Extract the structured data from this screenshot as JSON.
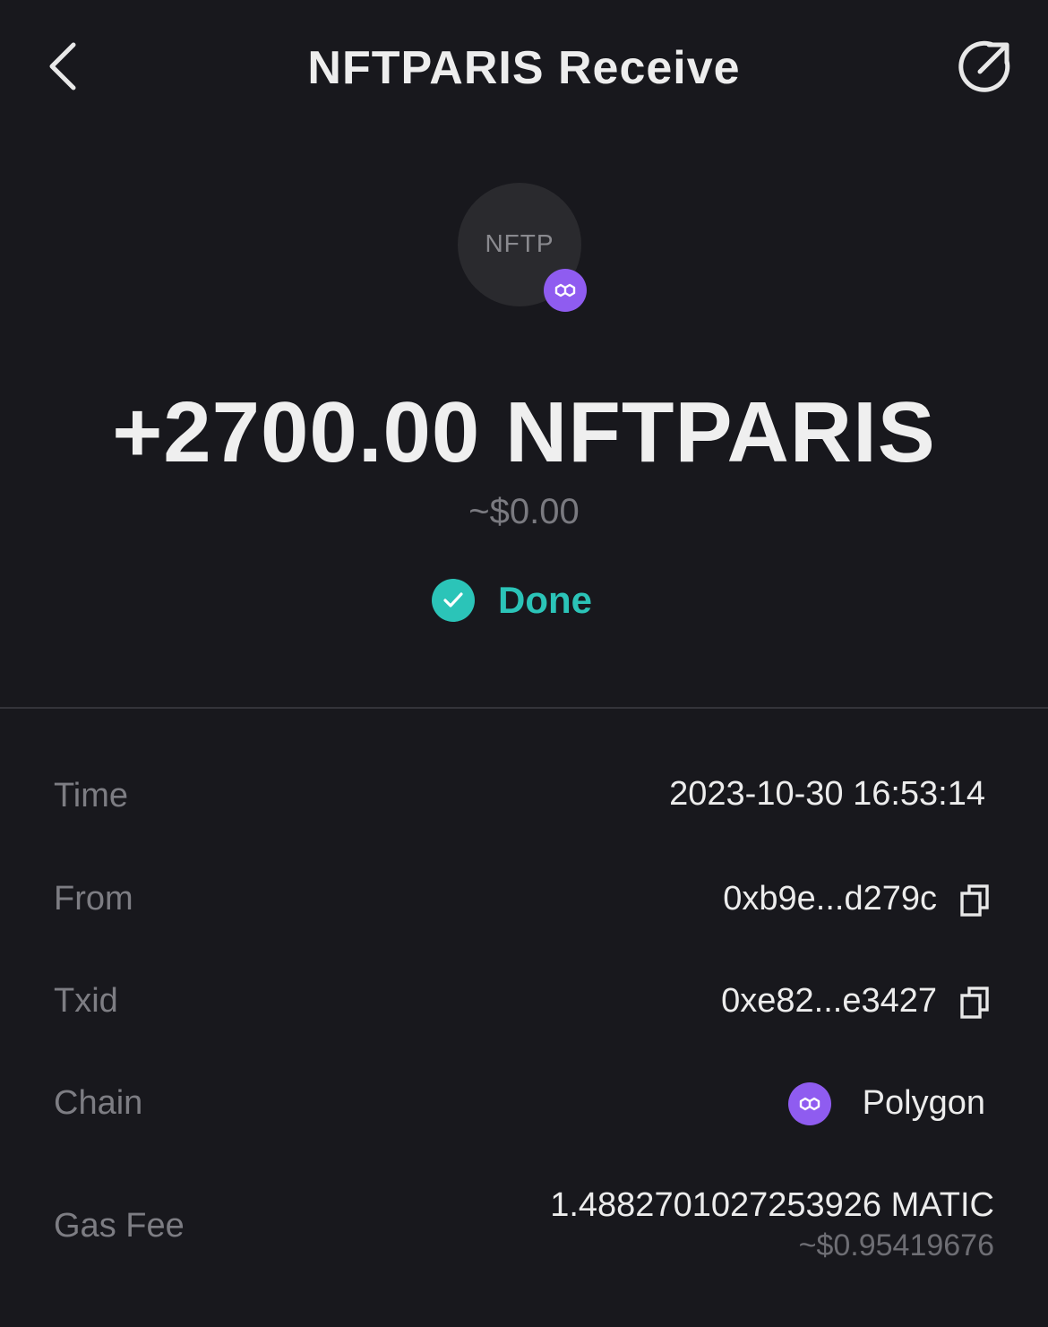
{
  "header": {
    "title": "NFTPARIS Receive",
    "back_icon": "chevron-left-icon",
    "share_icon": "external-link-icon"
  },
  "token": {
    "avatar_text": "NFTP",
    "chain_badge_icon": "polygon-icon"
  },
  "amount": "+2700.00 NFTPARIS",
  "fiat_amount": "~$0.00",
  "status": {
    "label": "Done",
    "icon": "check-circle-icon",
    "color": "#2bc4b8"
  },
  "details": {
    "time": {
      "label": "Time",
      "value": "2023-10-30 16:53:14"
    },
    "from": {
      "label": "From",
      "value": "0xb9e...d279c",
      "copy_icon": "copy-icon"
    },
    "txid": {
      "label": "Txid",
      "value": "0xe82...e3427",
      "copy_icon": "copy-icon"
    },
    "chain": {
      "label": "Chain",
      "value": "Polygon",
      "icon": "polygon-icon"
    },
    "gas_fee": {
      "label": "Gas Fee",
      "value": "1.4882701027253926 MATIC",
      "fiat": "~$0.95419676"
    }
  },
  "colors": {
    "background": "#18181d",
    "polygon_purple": "#8f5cf0",
    "success": "#2bc4b8"
  }
}
